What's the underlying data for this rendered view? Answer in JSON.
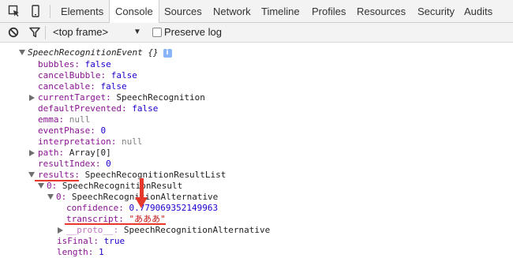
{
  "tabs": [
    {
      "label": "Elements",
      "selected": false
    },
    {
      "label": "Console",
      "selected": true
    },
    {
      "label": "Sources",
      "selected": false
    },
    {
      "label": "Network",
      "selected": false
    },
    {
      "label": "Timeline",
      "selected": false
    },
    {
      "label": "Profiles",
      "selected": false
    },
    {
      "label": "Resources",
      "selected": false
    },
    {
      "label": "Security",
      "selected": false
    },
    {
      "label": "Audits",
      "selected": false
    }
  ],
  "toolbar": {
    "frame_select": "<top frame>",
    "preserve_log_label": "Preserve log",
    "preserve_log_checked": false
  },
  "tree": {
    "root_label": "SpeechRecognitionEvent {}",
    "bubbles": {
      "key": "bubbles:",
      "value": "false"
    },
    "cancel_bubble": {
      "key": "cancelBubble:",
      "value": "false"
    },
    "cancelable": {
      "key": "cancelable:",
      "value": "false"
    },
    "current_target": {
      "key": "currentTarget:",
      "value": "SpeechRecognition"
    },
    "default_prevented": {
      "key": "defaultPrevented:",
      "value": "false"
    },
    "emma": {
      "key": "emma:",
      "value": "null"
    },
    "event_phase": {
      "key": "eventPhase:",
      "value": "0"
    },
    "interpretation": {
      "key": "interpretation:",
      "value": "null"
    },
    "path": {
      "key": "path:",
      "value": "Array[0]"
    },
    "result_index": {
      "key": "resultIndex:",
      "value": "0"
    },
    "results": {
      "key": "results:",
      "value": "SpeechRecognitionResultList"
    },
    "result_0": {
      "key": "0:",
      "value": "SpeechRecognitionResult"
    },
    "alternative_0": {
      "key": "0:",
      "value": "SpeechRecognitionAlternative"
    },
    "confidence": {
      "key": "confidence:",
      "value": "0.779069352149963"
    },
    "transcript": {
      "key": "transcript:",
      "value": "\"あああ\""
    },
    "alt_proto": {
      "key": "__proto__:",
      "value": "SpeechRecognitionAlternative"
    },
    "is_final": {
      "key": "isFinal:",
      "value": "true"
    },
    "length": {
      "key": "length:",
      "value": "1"
    }
  },
  "colors": {
    "annotation_red": "#e8382c",
    "property_key": "#881391",
    "number_bool": "#1c00cf",
    "string": "#c41a16",
    "null": "#808080"
  }
}
